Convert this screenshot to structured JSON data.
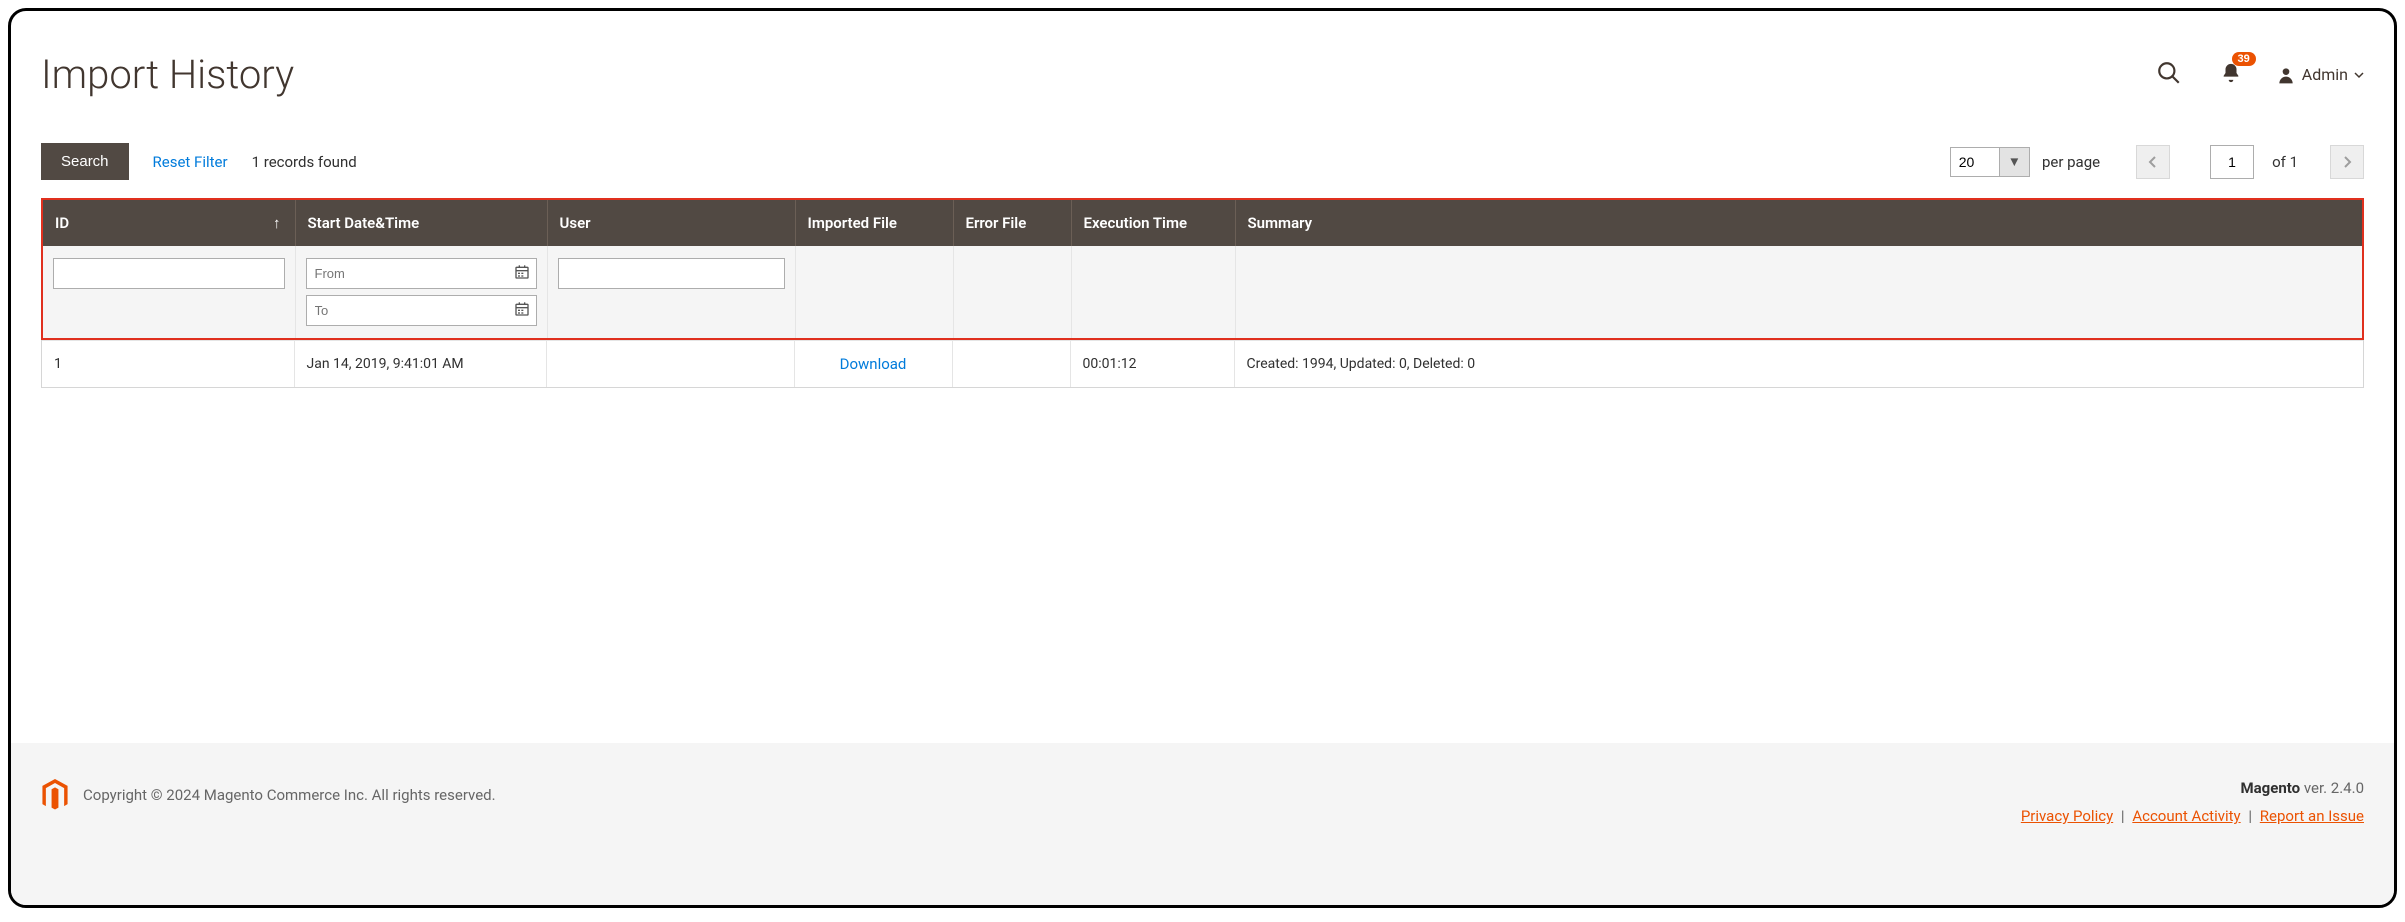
{
  "header": {
    "title": "Import History",
    "notification_count": "39",
    "user_label": "Admin"
  },
  "toolbar": {
    "search_label": "Search",
    "reset_label": "Reset Filter",
    "records_found": "1 records found",
    "per_page_value": "20",
    "per_page_label": "per page",
    "page_current": "1",
    "page_total_label": "of 1"
  },
  "table": {
    "columns": {
      "id": "ID",
      "start": "Start Date&Time",
      "user": "User",
      "imported": "Imported File",
      "error": "Error File",
      "exec": "Execution Time",
      "summary": "Summary"
    },
    "filters": {
      "from_placeholder": "From",
      "to_placeholder": "To"
    },
    "rows": [
      {
        "id": "1",
        "start": "Jan 14, 2019, 9:41:01 AM",
        "user": "",
        "imported": "Download",
        "error": "",
        "exec": "00:01:12",
        "summary": "Created: 1994, Updated: 0, Deleted: 0"
      }
    ]
  },
  "footer": {
    "copyright": "Copyright © 2024 Magento Commerce Inc. All rights reserved.",
    "brand": "Magento",
    "version": " ver. 2.4.0",
    "privacy": "Privacy Policy",
    "activity": " Account Activity",
    "report": "Report an Issue"
  }
}
